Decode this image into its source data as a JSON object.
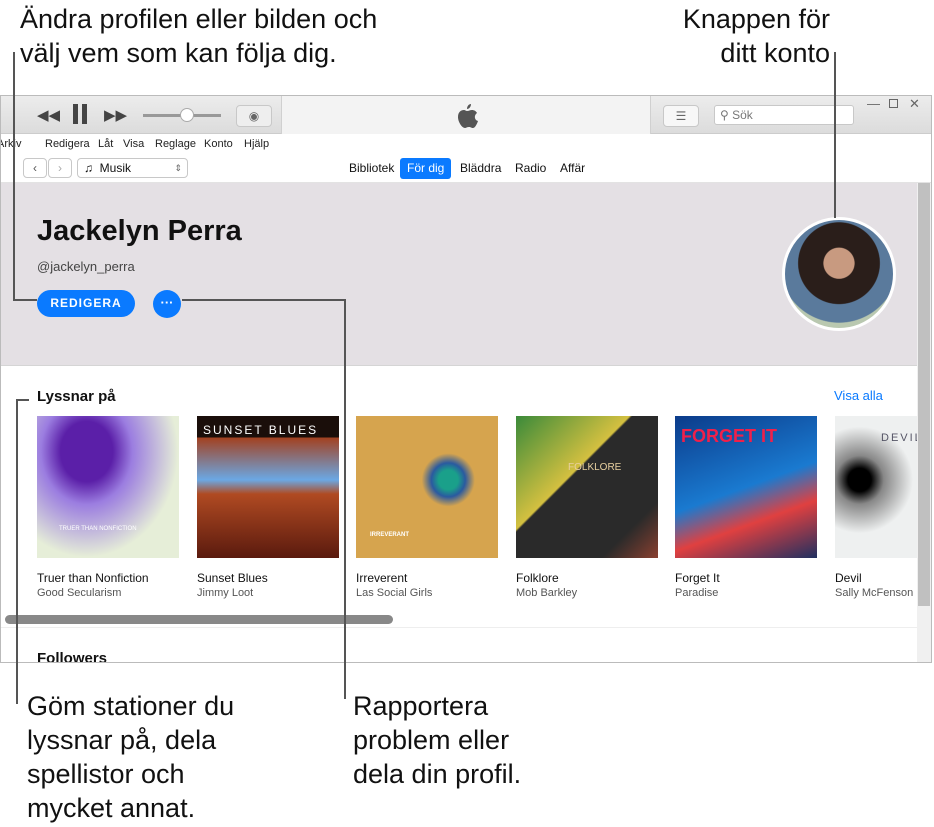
{
  "annotations": {
    "top_left": [
      "Ändra profilen eller bilden och",
      "välj vem som kan följa dig."
    ],
    "top_right": [
      "Knappen för",
      "ditt konto"
    ],
    "bottom_left": [
      "Göm stationer du",
      "lyssnar på, dela",
      "spellistor och",
      "mycket annat."
    ],
    "bottom_mid": [
      "Rapportera",
      "problem eller",
      "dela din profil."
    ]
  },
  "toolbar": {
    "search_placeholder": "Sök"
  },
  "menu": [
    "Arkiv",
    "Redigera",
    "Låt",
    "Visa",
    "Reglage",
    "Konto",
    "Hjälp"
  ],
  "nav": {
    "source": "Musik",
    "tabs": [
      "Bibliotek",
      "För dig",
      "Bläddra",
      "Radio",
      "Affär"
    ],
    "active_tab": "För dig",
    "accent": "#0a7aff"
  },
  "profile": {
    "name": "Jackelyn Perra",
    "handle": "@jackelyn_perra",
    "edit_label": "REDIGERA",
    "more_label": "···"
  },
  "listening": {
    "title": "Lyssnar på",
    "see_all": "Visa alla",
    "albums": [
      {
        "title": "Truer than Nonfiction",
        "artist": "Good Secularism",
        "cover_text": "TRUER THAN NONFICTION"
      },
      {
        "title": "Sunset Blues",
        "artist": "Jimmy Loot",
        "cover_text": "SUNSET BLUES"
      },
      {
        "title": "Irreverent",
        "artist": "Las Social Girls",
        "cover_text": "IRREVERANT"
      },
      {
        "title": "Folklore",
        "artist": "Mob Barkley",
        "cover_text": "FOLKLORE"
      },
      {
        "title": "Forget It",
        "artist": "Paradise",
        "cover_text": "FORGET IT"
      },
      {
        "title": "Devil",
        "artist": "Sally McFenson",
        "cover_text": "DEVIL"
      }
    ]
  },
  "followers": {
    "title": "Followers"
  }
}
